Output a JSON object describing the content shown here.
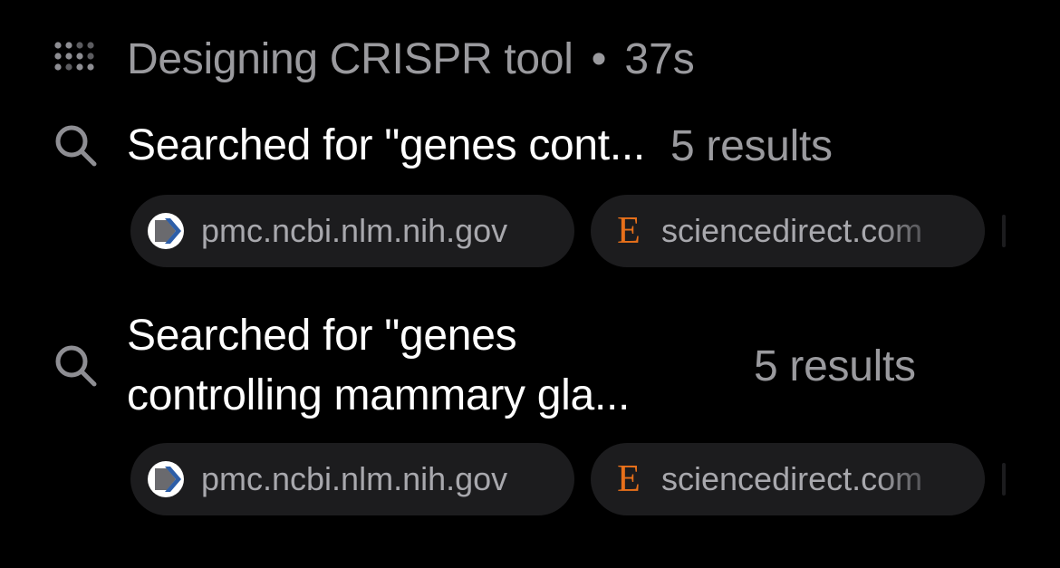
{
  "header": {
    "icon": "dots-grid-icon",
    "title": "Designing CRISPR tool",
    "separator": "•",
    "elapsed": "37s"
  },
  "steps": [
    {
      "icon": "search-icon",
      "text": "Searched for \"genes cont...",
      "results": "5 results",
      "sources": [
        {
          "icon": "pmc-icon",
          "label": "pmc.ncbi.nlm.nih.gov"
        },
        {
          "icon": "sciencedirect-icon",
          "glyph": "E",
          "label": "sciencedirect.com"
        }
      ]
    },
    {
      "icon": "search-icon",
      "text_line1": "Searched for \"genes",
      "text_line2": "controlling mammary gla...",
      "results": "5 results",
      "sources": [
        {
          "icon": "pmc-icon",
          "label": "pmc.ncbi.nlm.nih.gov"
        },
        {
          "icon": "sciencedirect-icon",
          "glyph": "E",
          "label": "sciencedirect.com"
        }
      ]
    }
  ],
  "colors": {
    "background": "#000000",
    "primary_text": "#ffffff",
    "secondary_text": "#9a9a9e",
    "chip_bg": "#1c1c1e",
    "sciencedirect_orange": "#e8701a",
    "pmc_blue": "#3a6fb0"
  }
}
